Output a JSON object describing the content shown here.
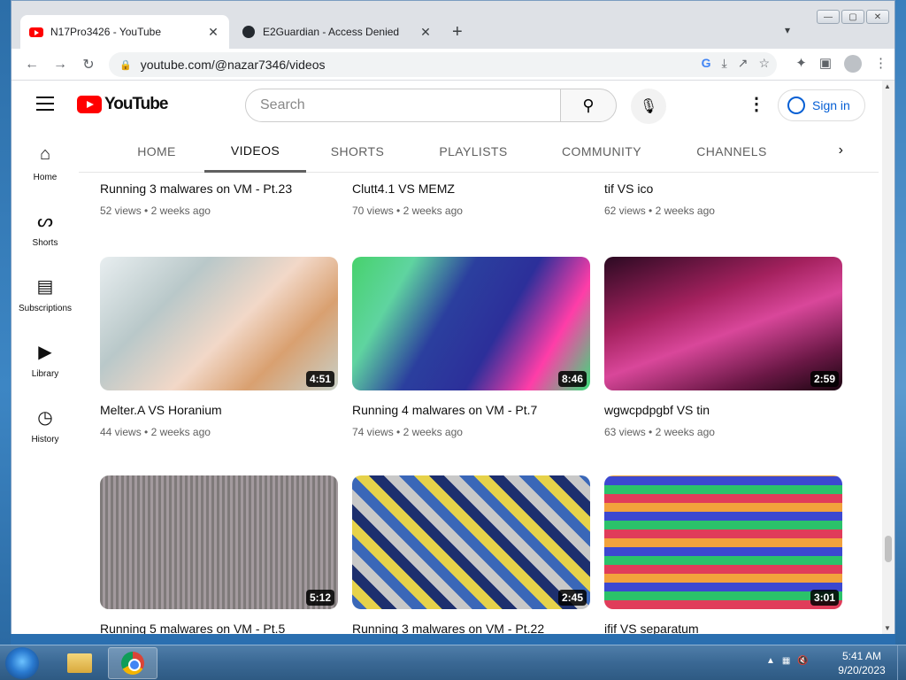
{
  "browser": {
    "tabs": [
      {
        "title": "N17Pro3426 - YouTube",
        "active": true,
        "favicon": "youtube-icon"
      },
      {
        "title": "E2Guardian - Access Denied",
        "active": false,
        "favicon": "github-icon"
      }
    ],
    "url": "youtube.com/@nazar7346/videos"
  },
  "masthead": {
    "logo_text": "YouTube",
    "search_placeholder": "Search",
    "signin_label": "Sign in"
  },
  "leftnav": {
    "items": [
      {
        "label": "Home",
        "icon": "home-icon"
      },
      {
        "label": "Shorts",
        "icon": "shorts-icon"
      },
      {
        "label": "Subscriptions",
        "icon": "subscriptions-icon"
      },
      {
        "label": "Library",
        "icon": "library-icon"
      },
      {
        "label": "History",
        "icon": "history-icon"
      }
    ]
  },
  "channel_tabs": [
    "HOME",
    "VIDEOS",
    "SHORTS",
    "PLAYLISTS",
    "COMMUNITY",
    "CHANNELS"
  ],
  "active_channel_tab": "VIDEOS",
  "videos": [
    {
      "title": "Running 3 malwares on VM - Pt.23",
      "views": "52 views",
      "age": "2 weeks ago"
    },
    {
      "title": "Clutt4.1 VS MEMZ",
      "views": "70 views",
      "age": "2 weeks ago"
    },
    {
      "title": "tif VS ico",
      "views": "62 views",
      "age": "2 weeks ago"
    },
    {
      "title": "Melter.A VS Horanium",
      "views": "44 views",
      "age": "2 weeks ago",
      "duration": "4:51"
    },
    {
      "title": "Running 4 malwares on VM - Pt.7",
      "views": "74 views",
      "age": "2 weeks ago",
      "duration": "8:46"
    },
    {
      "title": "wgwcpdpgbf VS tin",
      "views": "63 views",
      "age": "2 weeks ago",
      "duration": "2:59"
    },
    {
      "title": "Running 5 malwares on VM - Pt.5",
      "duration": "5:12"
    },
    {
      "title": "Running 3 malwares on VM - Pt.22",
      "duration": "2:45"
    },
    {
      "title": "ifif VS separatum",
      "duration": "3:01"
    }
  ],
  "taskbar": {
    "time": "5:41 AM",
    "date": "9/20/2023"
  }
}
